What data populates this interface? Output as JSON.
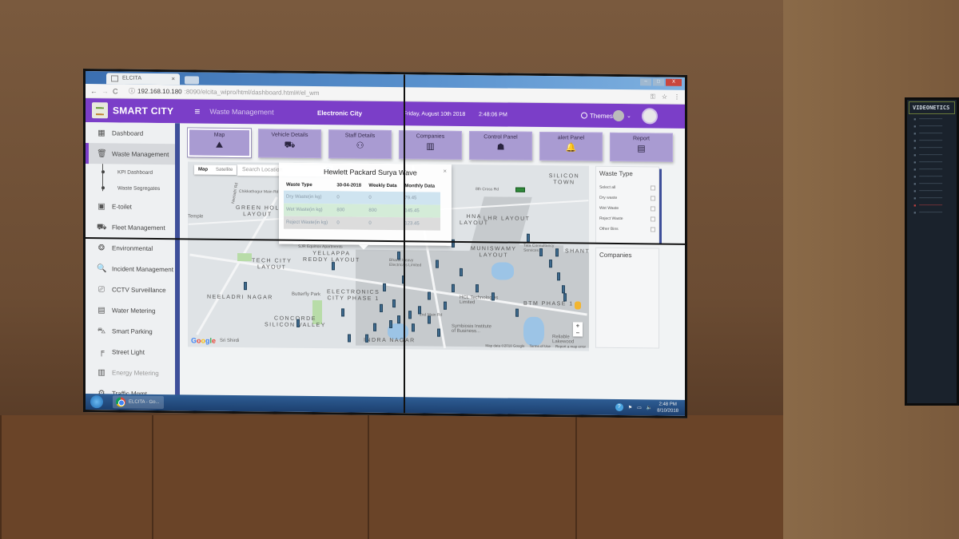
{
  "browser": {
    "tab_title": "ELCITA",
    "tab_close": "×",
    "url_host": "192.168.10.180",
    "url_path": ":8090/elcita_wipro/html/dashboard.html#/el_wm",
    "nav_back": "←",
    "nav_forward": "→",
    "nav_reload": "C",
    "info_icon": "ⓘ",
    "key_icon": "⚿",
    "star_icon": "☆",
    "menu_icon": "⋮",
    "window_controls": [
      "–",
      "□",
      "X"
    ]
  },
  "header": {
    "brand": "SMART CITY",
    "menu_icon": "≡",
    "module": "Waste Management",
    "city": "Electronic City",
    "date": "Friday, August 10th 2018",
    "time": "2:48:06 PM",
    "themes_label": "Themes",
    "caret": "⌄"
  },
  "sidebar": {
    "items": [
      {
        "label": "Dashboard",
        "icon": "▦"
      },
      {
        "label": "Waste Management",
        "icon": "🗑"
      },
      {
        "label": "E-toilet",
        "icon": "▣"
      },
      {
        "label": "Fleet Management",
        "icon": "⛟"
      },
      {
        "label": "Environmental",
        "icon": "❂"
      },
      {
        "label": "Incident Management",
        "icon": "🔍"
      },
      {
        "label": "CCTV Surveillance",
        "icon": "⎚"
      },
      {
        "label": "Water Metering",
        "icon": "▤"
      },
      {
        "label": "Smart Parking",
        "icon": "⛍"
      },
      {
        "label": "Street Light",
        "icon": "╒"
      },
      {
        "label": "Energy Metering",
        "icon": "▥"
      },
      {
        "label": "Traffic Mgmt.",
        "icon": "⚙"
      }
    ],
    "sub_items": [
      "KPI Dashboard",
      "Waste Segregates"
    ]
  },
  "tiles": [
    {
      "label": "Map",
      "icon": "⛰"
    },
    {
      "label": "Vehicle Details",
      "icon": "⛟"
    },
    {
      "label": "Staff Details",
      "icon": "⚇"
    },
    {
      "label": "Companies",
      "icon": "▥"
    },
    {
      "label": "Control Panel",
      "icon": "☗"
    },
    {
      "label": "alert Panel",
      "icon": "🔔"
    },
    {
      "label": "Report",
      "icon": "▤"
    }
  ],
  "map": {
    "type_map": "Map",
    "type_satellite": "Satellite",
    "search_placeholder": "Search Location",
    "search_icon": "🔍",
    "labels": {
      "green_hol": "GREEN HOL\nLAYOUT",
      "temple": "Temple",
      "tech_city": "TECH CITY\nLAYOUT",
      "neeladri": "NEELADRI NAGAR",
      "yellappa": "YELLAPPA\nREDDY LAYOUT",
      "electronics_city": "ELECTRONICS\nCITY PHASE 1",
      "concorde": "CONCORDE\nSILICON VALLEY",
      "indra_nagar": "INDRA NAGAR",
      "muniswamy": "MUNISWAMY\nLAYOUT",
      "lhr": "LHR LAYOUT",
      "silicon_town": "SILICON TOWN",
      "shanthi": "SHANTH",
      "btm": "BTM PHASE 1",
      "hna": "HNA\nLAYOUT",
      "sjr": "SJR Equinox Apartments",
      "butterfly": "Butterfly Park",
      "hcl": "HCL Technologies\nLimited",
      "symbiosis": "Symbiosis Institute\nof Business...",
      "tcs": "Tata Consultancy\nServices",
      "bharat": "Bharat Heavy\nElectricals Limited",
      "chikkathogur": "Chikkathogur Main Rd",
      "neeladri_rd": "Neeladri Rd",
      "main_rd": "2nd Main Rd",
      "cross_rd": "8th Cross Rd",
      "sri_shirdi": "Sri Shirdi",
      "reliable": "Reliable Lakewood"
    },
    "footer": [
      "Map data ©2018 Google",
      "Terms of Use",
      "Report a map error"
    ],
    "zoom_in": "+",
    "zoom_out": "−"
  },
  "popup": {
    "title": "Hewlett Packard Surya Wave",
    "close": "×",
    "columns": [
      "Waste Type",
      "30-04-2018",
      "Weekly Data",
      "Monthly Data"
    ],
    "rows": [
      [
        "Dry Waste(in kg)",
        "0",
        "0",
        "79.45"
      ],
      [
        "Wet Waste(in kg)",
        "800",
        "800",
        "145.45"
      ],
      [
        "Reject Waste(in kg)",
        "0",
        "0",
        "123.45"
      ]
    ]
  },
  "filters": {
    "waste_type_title": "Waste Type",
    "options": [
      "Select all",
      "Dry waste",
      "Wet Waste",
      "Reject Waste",
      "Other Bins"
    ],
    "companies_title": "Companies"
  },
  "taskbar": {
    "app_label": "ELCITA - Go...",
    "time": "2:48 PM",
    "date": "8/10/2018",
    "help": "?"
  },
  "side_monitor": {
    "brand": "VIDEONETICS"
  },
  "colors": {
    "header_purple": "#7b3ec8",
    "tile_lavender": "#a99bd2",
    "sidebar_accent": "#3e4f9a",
    "bin_blue": "#3d6a8e"
  }
}
